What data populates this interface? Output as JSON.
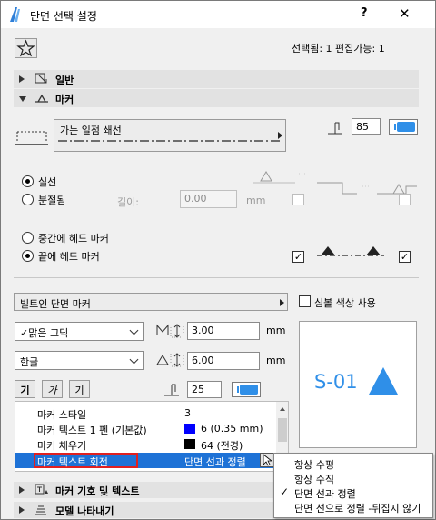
{
  "window": {
    "title": "단면 선택 설정",
    "help": "?",
    "close": "✕"
  },
  "header": {
    "selection_info": "선택됨: 1 편집가능: 1"
  },
  "sections": {
    "general": "일반",
    "marker": "마커",
    "marker_symbol_text": "마커 기호 및 텍스트",
    "model_display": "모델 나타내기"
  },
  "line_type": {
    "name": "가는 일점 쇄선",
    "pen_value": "85"
  },
  "line_options": {
    "solid": "실선",
    "broken": "분절됨",
    "length_label": "길이:",
    "length_value": "0.00",
    "length_unit": "mm"
  },
  "head_marker": {
    "middle": "중간에 헤드 마커",
    "end": "끝에 헤드 마커"
  },
  "marker_type": {
    "selected": "빌트인 단면 마커",
    "symbol_color_label": "심볼 색상 사용"
  },
  "font": {
    "family": "맑은 고딕",
    "script": "한글",
    "size_value": "3.00",
    "size_unit": "mm",
    "spacing_value": "6.00",
    "spacing_unit": "mm",
    "pen_value": "25",
    "style_bold": "기",
    "style_italic": "가",
    "style_underline": "기"
  },
  "preview": {
    "label": "S-01",
    "accent": "#2f8fe8"
  },
  "properties": {
    "rows": [
      {
        "name": "마커 스타일",
        "value": "3"
      },
      {
        "name": "마커 텍스트 1 펜 (기본값)",
        "value": "6 (0.35 mm)",
        "swatch": "#0000ff"
      },
      {
        "name": "마커 채우기",
        "value": "64 (전경)",
        "swatch": "#000000"
      },
      {
        "name": "마커 텍스트 회전",
        "value": "단면 선과 정렬"
      }
    ]
  },
  "rotation_menu": {
    "items": [
      {
        "label": "항상 수평",
        "checked": false
      },
      {
        "label": "항상 수직",
        "checked": false
      },
      {
        "label": "단면 선과 정렬",
        "checked": true
      },
      {
        "label": "단면 선으로 정렬 -뒤집지 않기",
        "checked": false
      }
    ]
  }
}
